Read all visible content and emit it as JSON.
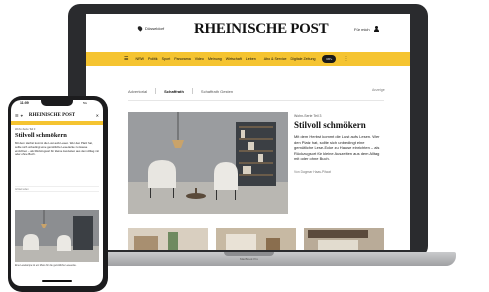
{
  "laptop": {
    "model_label": "MacBook Pro",
    "site": {
      "location": "Düsseldorf",
      "brand": "RHEINISCHE POST",
      "login_label": "Für mich",
      "menu_icon": "hamburger-icon",
      "nav": [
        "NRW",
        "Politik",
        "Sport",
        "Panorama",
        "Video",
        "Meinung",
        "Wirtschaft",
        "Leben",
        "Abo & Service",
        "Digitale Zeitung"
      ],
      "nav_pill": "RP+",
      "subnav": [
        "Advertorial",
        "Schaffrath",
        "Schaffrath Gesten"
      ],
      "subnav_active_index": 1,
      "subnav_right": "Anzeige",
      "hero": {
        "kicker": "Wohn-Serie Teil 3",
        "title": "Stilvoll schmökern",
        "text": "Mit dem Herbst kommt die Lust aufs Lesen. Wer den Platz hat, sollte sich unbedingt eine gemütliche Lese-Ecke zu Hause einrichten – als Rückzugsort für kleine Auszeiten aus dem Alltag mit oder ohne Buch.",
        "author": "Von Dagmar Haas-Pilwat"
      }
    }
  },
  "phone": {
    "time": "11:09",
    "status": "5G",
    "brand": "RHEINISCHE POST",
    "kicker": "Wohn-Serie Teil 3",
    "title": "Stilvoll schmökern",
    "text": "Mit dem Herbst kommt die Lust aufs Lesen. Wer den Platz hat, sollte sich unbedingt eine gemütliche Lese-Ecke zu Hause einrichten – als Rückzugsort für kleine Auszeiten aus dem Alltag mit oder ohne Buch.",
    "share": "Artikel teilen",
    "caption": "Eine Leselampe ist ein Muss für die gemütliche Leseecke."
  },
  "colors": {
    "brand_yellow": "#f5c431",
    "laptop_frame": "#2a2b2e",
    "phone_frame": "#1c1c1e"
  }
}
